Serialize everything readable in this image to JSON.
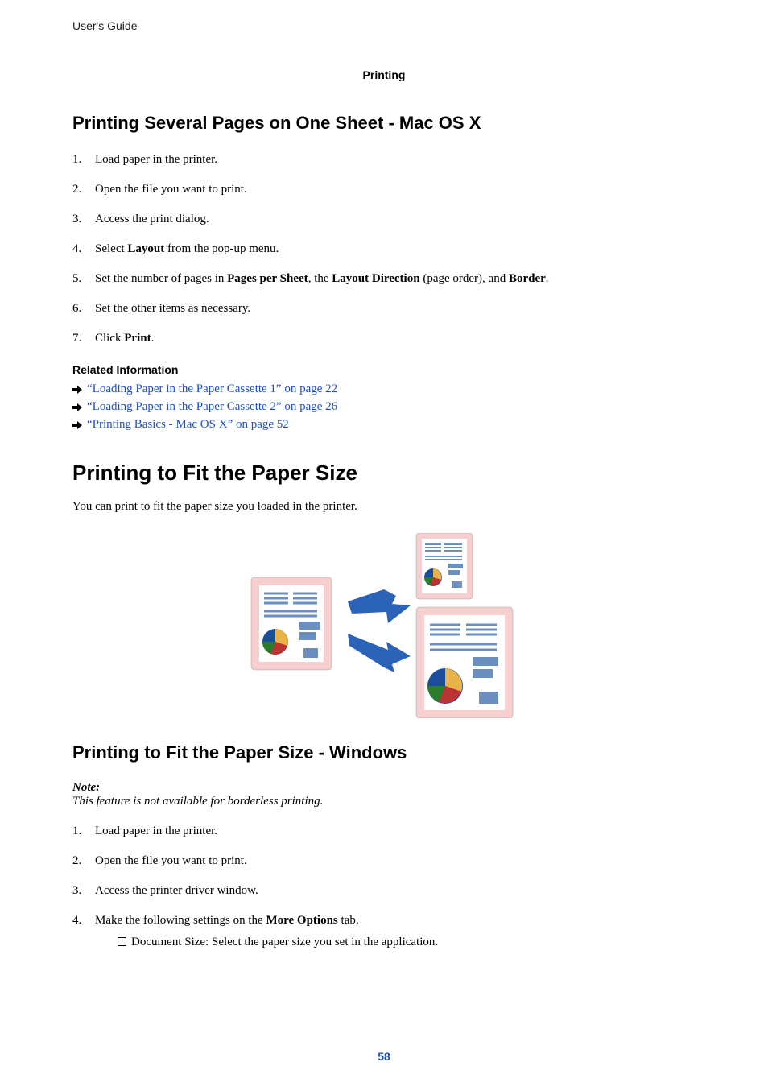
{
  "header": "User's Guide",
  "chapter": "Printing",
  "section1": {
    "title": "Printing Several Pages on One Sheet - Mac OS X",
    "steps": [
      "Load paper in the printer.",
      "Open the file you want to print.",
      "Access the print dialog.",
      "Select <b>Layout</b> from the pop-up menu.",
      "Set the number of pages in <b>Pages per Sheet</b>, the <b>Layout Direction</b> (page order), and <b>Border</b>.",
      "Set the other items as necessary.",
      "Click <b>Print</b>."
    ]
  },
  "related": {
    "title": "Related Information",
    "links": [
      "“Loading Paper in the Paper Cassette 1” on page 22",
      "“Loading Paper in the Paper Cassette 2” on page 26",
      "“Printing Basics - Mac OS X” on page 52"
    ]
  },
  "section2": {
    "title": "Printing to Fit the Paper Size",
    "intro": "You can print to fit the paper size you loaded in the printer."
  },
  "section3": {
    "title": "Printing to Fit the Paper Size - Windows",
    "noteLabel": "Note:",
    "noteBody": "This feature is not available for borderless printing.",
    "steps": [
      "Load paper in the printer.",
      "Open the file you want to print.",
      "Access the printer driver window.",
      "Make the following settings on the <b>More Options</b> tab."
    ],
    "substep": "Document Size: Select the paper size you set in the application."
  },
  "pageNumber": "58"
}
